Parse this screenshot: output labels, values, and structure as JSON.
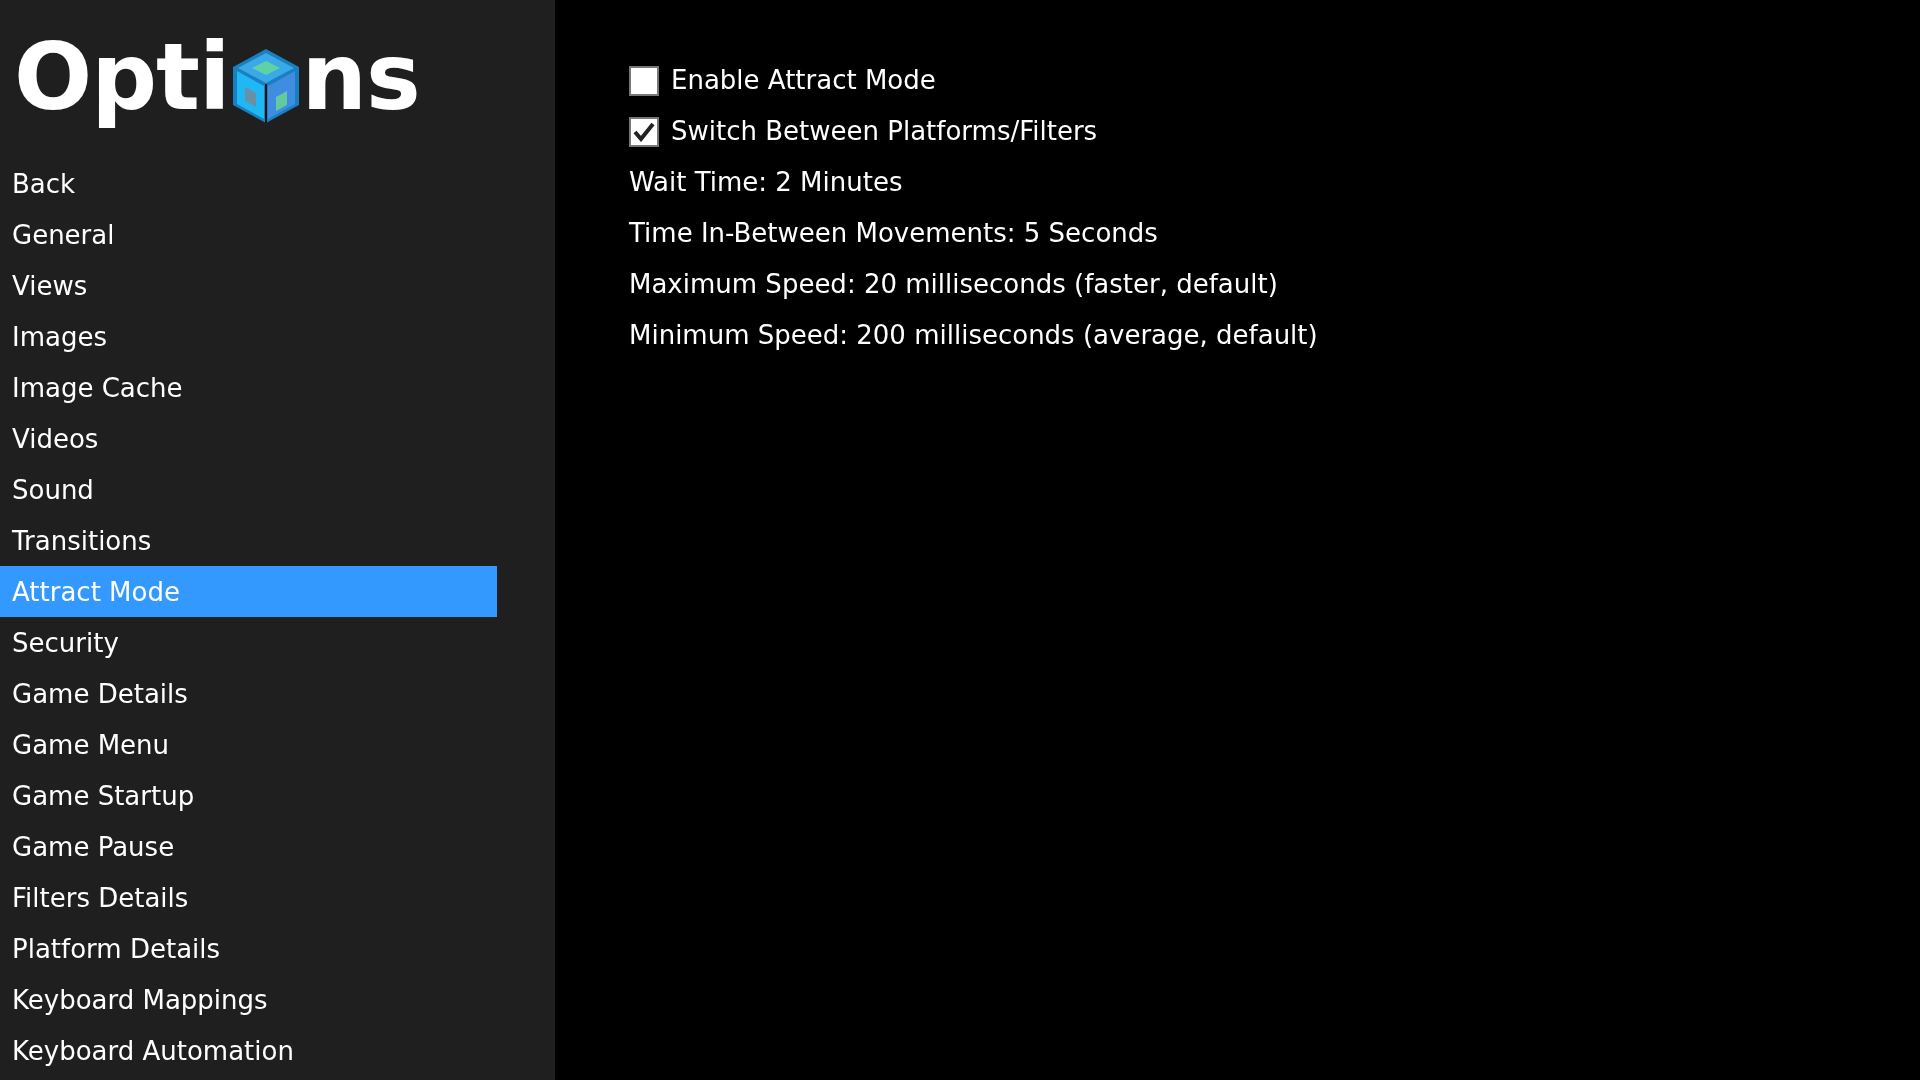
{
  "logo": {
    "text_before": "Opti",
    "text_after": "ns"
  },
  "sidebar": {
    "items": [
      {
        "label": "Back",
        "selected": false
      },
      {
        "label": "General",
        "selected": false
      },
      {
        "label": "Views",
        "selected": false
      },
      {
        "label": "Images",
        "selected": false
      },
      {
        "label": "Image Cache",
        "selected": false
      },
      {
        "label": "Videos",
        "selected": false
      },
      {
        "label": "Sound",
        "selected": false
      },
      {
        "label": "Transitions",
        "selected": false
      },
      {
        "label": "Attract Mode",
        "selected": true
      },
      {
        "label": "Security",
        "selected": false
      },
      {
        "label": "Game Details",
        "selected": false
      },
      {
        "label": "Game Menu",
        "selected": false
      },
      {
        "label": "Game Startup",
        "selected": false
      },
      {
        "label": "Game Pause",
        "selected": false
      },
      {
        "label": "Filters Details",
        "selected": false
      },
      {
        "label": "Platform Details",
        "selected": false
      },
      {
        "label": "Keyboard Mappings",
        "selected": false
      },
      {
        "label": "Keyboard Automation",
        "selected": false
      }
    ]
  },
  "settings": [
    {
      "kind": "checkbox",
      "label": "Enable Attract Mode",
      "checked": false
    },
    {
      "kind": "checkbox",
      "label": "Switch Between Platforms/Filters",
      "checked": true
    },
    {
      "kind": "value",
      "label": "Wait Time: 2 Minutes"
    },
    {
      "kind": "value",
      "label": "Time In-Between Movements: 5 Seconds"
    },
    {
      "kind": "value",
      "label": "Maximum Speed: 20 milliseconds (faster, default)"
    },
    {
      "kind": "value",
      "label": "Minimum Speed: 200 milliseconds (average, default)"
    }
  ]
}
